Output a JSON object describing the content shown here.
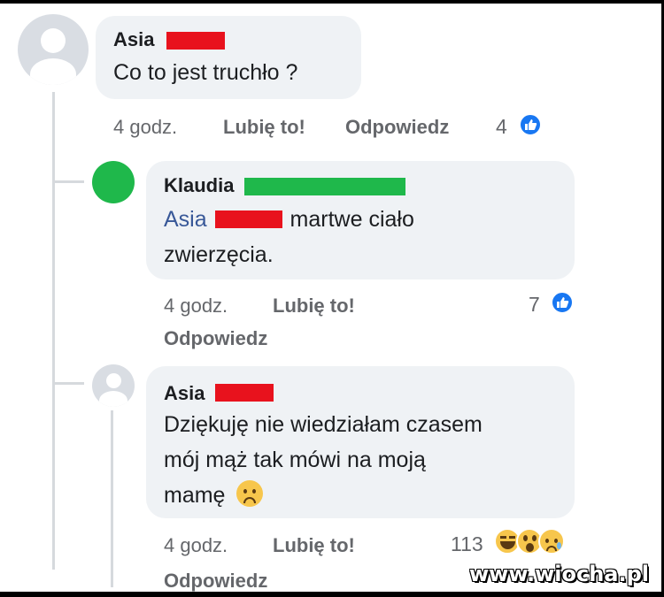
{
  "colors": {
    "bubble": "#eff2f5",
    "redaction_red": "#e8121d",
    "redaction_green": "#1fb84b",
    "avatar_green": "#1fb84b",
    "like_blue": "#1877f2",
    "mention": "#385898"
  },
  "comments": [
    {
      "author": "Asia",
      "text": "Co to jest truchło ?",
      "time": "4 godz.",
      "like_label": "Lubię to!",
      "reply_label": "Odpowiedz",
      "reaction_count": "4",
      "reaction_icons": [
        "like-icon"
      ]
    },
    {
      "author": "Klaudia",
      "mention": "Asia",
      "text_line1": "martwe ciało",
      "text_line2": "zwierzęcia.",
      "time": "4 godz.",
      "like_label": "Lubię to!",
      "reply_label": "Odpowiedz",
      "reaction_count": "7",
      "reaction_icons": [
        "like-icon"
      ]
    },
    {
      "author": "Asia",
      "text_line1": "Dziękuję nie wiedziałam czasem",
      "text_line2": "mój mąż tak mówi na moją",
      "text_line3": "mamę",
      "time": "4 godz.",
      "like_label": "Lubię to!",
      "reply_label": "Odpowiedz",
      "reaction_count": "113",
      "reaction_icons": [
        "haha-icon",
        "wow-icon",
        "sad-icon"
      ]
    }
  ],
  "watermark": "www.wiocha.pl"
}
